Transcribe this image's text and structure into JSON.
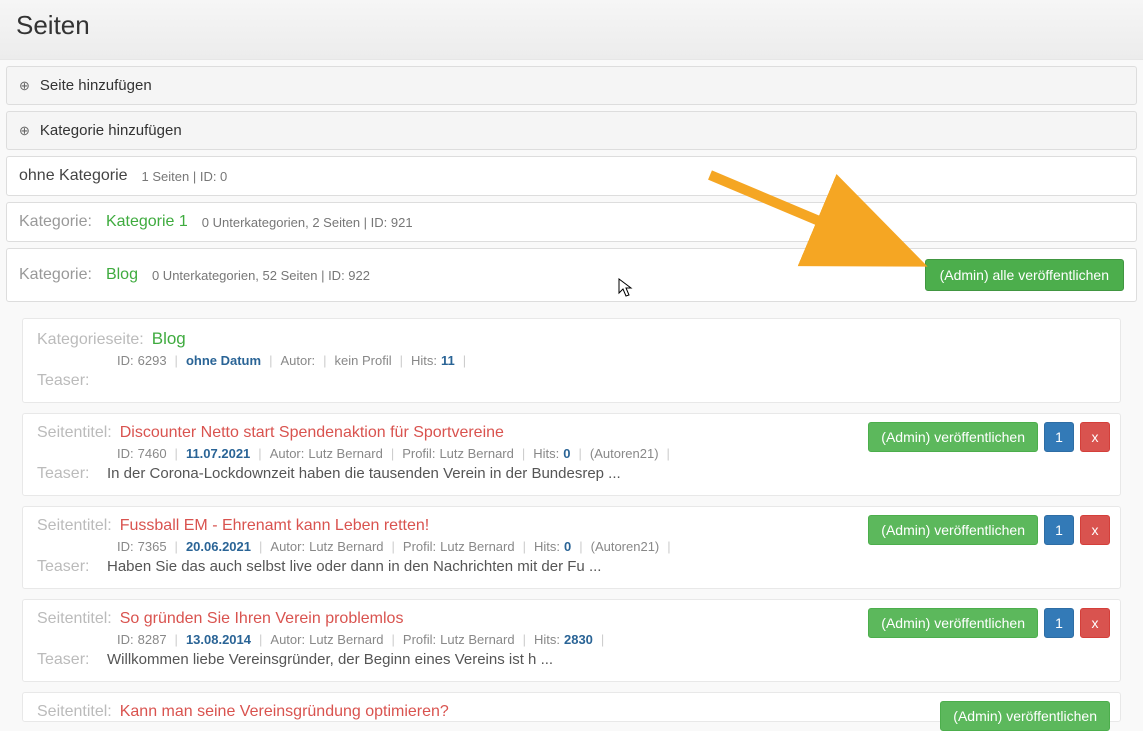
{
  "header": {
    "title": "Seiten"
  },
  "toolbar": {
    "add_page": "Seite hinzufügen",
    "add_category": "Kategorie hinzufügen"
  },
  "labels": {
    "kategorie": "Kategorie:",
    "kategorieseite": "Kategorieseite:",
    "seitentitel": "Seitentitel:",
    "teaser": "Teaser:",
    "id": "ID:",
    "autor": "Autor:",
    "profil": "Profil:",
    "hits": "Hits:",
    "kein_profil": "kein Profil",
    "ohne_datum": "ohne Datum"
  },
  "buttons": {
    "publish_all": "(Admin) alle veröffentlichen",
    "publish": "(Admin) veröffentlichen",
    "one": "1",
    "delete": "x"
  },
  "categories": {
    "uncategorized": {
      "label": "ohne Kategorie",
      "meta": "1 Seiten   |   ID: 0"
    },
    "cat1": {
      "name": "Kategorie 1",
      "meta": "0 Unterkategorien, 2 Seiten   |   ID: 921"
    },
    "blog": {
      "name": "Blog",
      "meta": "0 Unterkategorien, 52 Seiten   |   ID: 922"
    }
  },
  "catpage": {
    "name": "Blog",
    "id": "6293",
    "hits": "11"
  },
  "pages": [
    {
      "title": "Discounter Netto start Spendenaktion für Sportvereine",
      "id": "7460",
      "date": "11.07.2021",
      "author": "Lutz Bernard",
      "profile": "Lutz Bernard",
      "hits": "0",
      "extra": "(Autoren21)",
      "teaser": "In der Corona-Lockdownzeit haben die tausenden Verein in der Bundesrep ..."
    },
    {
      "title": "Fussball EM - Ehrenamt kann Leben retten!",
      "id": "7365",
      "date": "20.06.2021",
      "author": "Lutz Bernard",
      "profile": "Lutz Bernard",
      "hits": "0",
      "extra": "(Autoren21)",
      "teaser": "Haben Sie das auch selbst live oder dann in den Nachrichten mit der Fu ..."
    },
    {
      "title": "So gründen Sie Ihren Verein problemlos",
      "id": "8287",
      "date": "13.08.2014",
      "author": "Lutz Bernard",
      "profile": "Lutz Bernard",
      "hits": "2830",
      "extra": "",
      "teaser": "Willkommen liebe Vereinsgründer, der Beginn  eines Vereins ist h ..."
    },
    {
      "title": "Kann man seine Vereinsgründung optimieren?",
      "id": "",
      "date": "",
      "author": "",
      "profile": "",
      "hits": "",
      "extra": "",
      "teaser": ""
    }
  ]
}
